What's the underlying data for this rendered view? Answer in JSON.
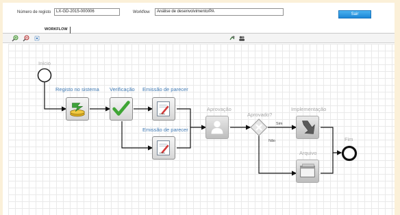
{
  "header": {
    "registro_label": "Número de registo",
    "registro_value": "LX-GD-2015-000006",
    "workflow_label": "Workflow",
    "workflow_value": "Análise de desenvolvimento/PA",
    "sair_label": "Sair"
  },
  "tabs": {
    "workflow": "WORKFLOW"
  },
  "toolbar": {
    "left_icons": [
      "zoom-in-icon",
      "zoom-out-icon",
      "fit-icon"
    ],
    "right_icons": [
      "flow-refresh-icon",
      "user-group-icon"
    ]
  },
  "diagram": {
    "start_label": "Início",
    "end_label": "Fim",
    "steps": {
      "registo": "Registo no sistema",
      "verificacao": "Verificação",
      "emissao1": "Emissão de parecer",
      "emissao2": "Emissão de parecer",
      "aprovacao": "Aprovação",
      "aprovado": "Aprovado?",
      "implementacao": "Implementação",
      "arquivo": "Arquivo"
    },
    "branches": {
      "sim": "Sim",
      "nao": "Não"
    },
    "colors": {
      "active_label": "#3f79b3",
      "inactive_label": "#a5a5a5",
      "check": "#3fa535"
    }
  }
}
